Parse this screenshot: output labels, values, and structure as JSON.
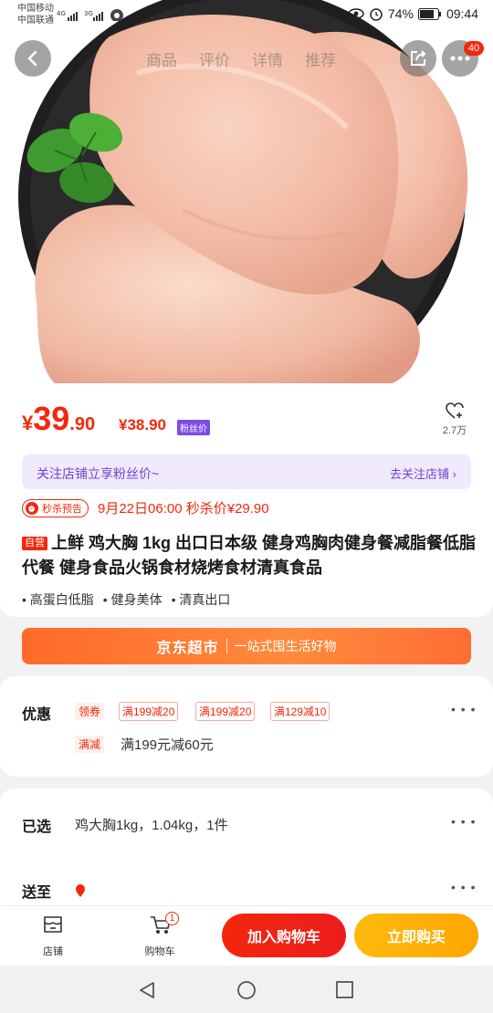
{
  "status_bar": {
    "carrier_1": "中国移动",
    "carrier_2": "中国联通",
    "battery": "74%",
    "time": "09:44"
  },
  "nav": {
    "tabs": [
      "商品",
      "评价",
      "详情",
      "推荐"
    ],
    "message_count": "40",
    "icons": {
      "back": "chevron-left-icon",
      "share": "share-icon",
      "more": "more-icon"
    }
  },
  "product": {
    "price_symbol": "¥",
    "price_int": "39",
    "price_dec": ".90",
    "fans_price": "¥38.90",
    "fans_price_tag": "粉丝价",
    "favorites_count": "2.7万",
    "follow_bar": {
      "text": "关注店铺立享粉丝价~",
      "action": "去关注店铺"
    },
    "flash_sale": {
      "tag": "秒杀预告",
      "text": "9月22日06:00 秒杀价¥29.90"
    },
    "self_operated_tag": "自营",
    "title": "上鲜 鸡大胸 1kg 出口日本级 健身鸡胸肉健身餐减脂餐低脂代餐 健身食品火锅食材烧烤食材清真食品",
    "features": [
      "高蛋白低脂",
      "健身美体",
      "清真出口"
    ]
  },
  "market_banner": {
    "name": "京东超市",
    "slogan": "一站式囤生活好物"
  },
  "promotion": {
    "label": "优惠",
    "coupon_tag": "领券",
    "coupons": [
      "满199减20",
      "满199减20",
      "满129减10"
    ],
    "discount_tag": "满减",
    "discount_text": "满199元减60元"
  },
  "selection": {
    "label": "已选",
    "value": "鸡大胸1kg，1.04kg，1件",
    "delivery_label": "送至"
  },
  "bottom_bar": {
    "shop": "店铺",
    "cart": "购物车",
    "cart_count": "1",
    "add_to_cart": "加入购物车",
    "buy_now": "立即购买"
  },
  "colors": {
    "accent": "#f2270c",
    "buy": "#ffa600",
    "fans": "#7b4be6",
    "market": "#ff7a33"
  }
}
